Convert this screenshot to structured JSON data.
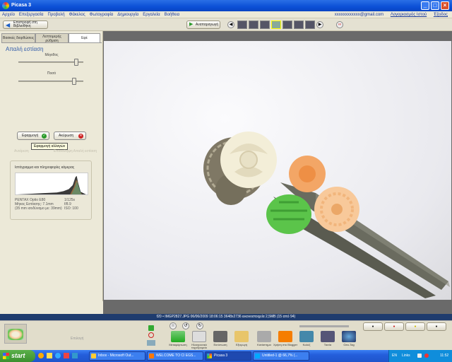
{
  "window": {
    "title": "Picasa 3"
  },
  "menu": {
    "items": [
      "Αρχείο",
      "Επεξεργασία",
      "Προβολή",
      "Φάκελος",
      "Φωτογραφία",
      "Δημιουργία",
      "Εργαλεία",
      "Βοήθεια"
    ],
    "email": "xxxxxxxxxxxx@gmail.com",
    "web_albums": "Λογαριασμός Ιστού",
    "signout": "Έξοδος"
  },
  "toolbar": {
    "back_label": "Επιστροφή στη Βιβλιοθήκη",
    "play_label": "Αναπαραγωγή"
  },
  "tabs": [
    "Βασικές διορθώσεις",
    "Λεπτομερής ρύθμιση",
    "Εφέ"
  ],
  "panel": {
    "title": "Απαλή εστίαση",
    "size_label": "Μέγεθος",
    "amount_label": "Ποσό",
    "size_value": 0.92,
    "amount_value": 0.88,
    "apply_label": "Εφαρμογή",
    "cancel_label": "Ακύρωση",
    "tooltip": "Εφαρμογή αλλαγών",
    "faded_left": "Αναίρεση",
    "faded_right": "Επανάληψη Απαλή εστίαση"
  },
  "histogram": {
    "title": "Ιστόγραμμα και πληροφορίες κάμερας",
    "camera": "PENTAX Optio E80",
    "focal": "Μήκος Εστίασης: 7.1mm",
    "focal35": "(35 mm ισοδύναμο με: 39mm)",
    "shutter": "1/125s",
    "aperture": "f/8.9",
    "iso": "ISO: 100"
  },
  "status": {
    "text": "f20 • IMGP2827.JPG   06/06/2009 18:06:15   3648x2736 εικονοστοιχεία   2,5MB   (15 από 94)"
  },
  "tray": {
    "hold_label": "Επιλογή",
    "actions": [
      "Μεταφόρτωση",
      "Ηλεκτρονικό ταχυδρομείο",
      "Εκτύπωση",
      "Εξαγωγή",
      "Κατάστημα",
      "Χρήση στο Blogger",
      "Κολάζ",
      "Ταινία",
      "Geo-Tag"
    ]
  },
  "taskbar": {
    "start": "start",
    "items": [
      "Inbox - Microsoft Out...",
      "WELCOME TO CI EGS...",
      "Picasa 3",
      "Untitled-1 @ 66,7% (..."
    ],
    "lang": "EN",
    "links": "Links",
    "time": "11:52"
  }
}
